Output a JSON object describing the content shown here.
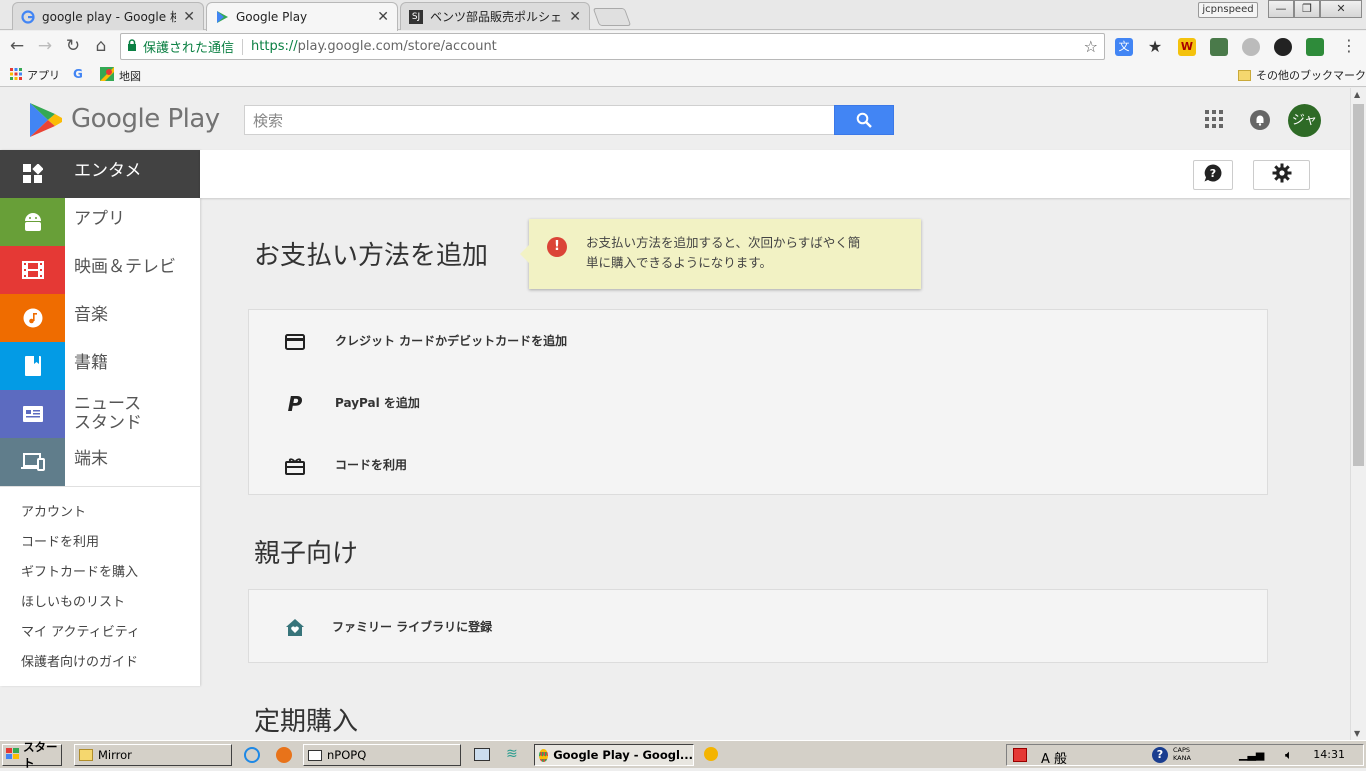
{
  "browser": {
    "tabs": [
      {
        "title": "google play - Google 検索",
        "icon": "google-g-icon",
        "active": false
      },
      {
        "title": "Google Play",
        "icon": "play-store-icon",
        "active": true
      },
      {
        "title": "ベンツ部品販売ポルシェBMW",
        "icon": "sj-site-icon",
        "active": false
      }
    ],
    "profile_name": "jcpnspeed",
    "address": {
      "secure_label": "保護された通信",
      "url_scheme": "https://",
      "url_host_path": "play.google.com/store/account"
    },
    "bookmarks": {
      "apps_label": "アプリ",
      "maps_label": "地図",
      "other_label": "その他のブックマーク"
    }
  },
  "play": {
    "logo_text": "Google Play",
    "search_placeholder": "検索",
    "avatar_initials": "ジャ",
    "categories": [
      {
        "label": "エンタメ",
        "color": "#424242",
        "icon": "grid-icon"
      },
      {
        "label": "アプリ",
        "color": "#689f38",
        "icon": "android-icon"
      },
      {
        "label": "映画＆テレビ",
        "color": "#e53935",
        "icon": "film-icon"
      },
      {
        "label": "音楽",
        "color": "#ef6c00",
        "icon": "music-note-icon"
      },
      {
        "label": "書籍",
        "color": "#039be5",
        "icon": "book-icon"
      },
      {
        "label": "ニュース\nスタンド",
        "color": "#5c6bc0",
        "icon": "newspaper-icon"
      },
      {
        "label": "端末",
        "color": "#607d8b",
        "icon": "devices-icon"
      }
    ],
    "sidebar_links": [
      "アカウント",
      "コードを利用",
      "ギフトカードを購入",
      "ほしいものリスト",
      "マイ アクティビティ",
      "保護者向けのガイド"
    ],
    "sections": {
      "payment_title": "お支払い方法を追加",
      "payment_rows": [
        "クレジット カードかデビットカードを追加",
        "PayPal を追加",
        "コードを利用"
      ],
      "family_title": "親子向け",
      "family_rows": [
        "ファミリー ライブラリに登録"
      ],
      "subscription_title": "定期購入"
    },
    "tooltip": {
      "line1": "お支払い方法を追加すると、次回からすばやく簡",
      "line2": "単に購入できるようになります。"
    },
    "accent": "#4285f4"
  },
  "taskbar": {
    "start_label": "スタート",
    "tasks": [
      "Mirror",
      "nPOPQ",
      "Google Play - Googl..."
    ],
    "clock": "14:31",
    "tray_ime": "A 般",
    "caps_label": "CAPS KANA"
  }
}
